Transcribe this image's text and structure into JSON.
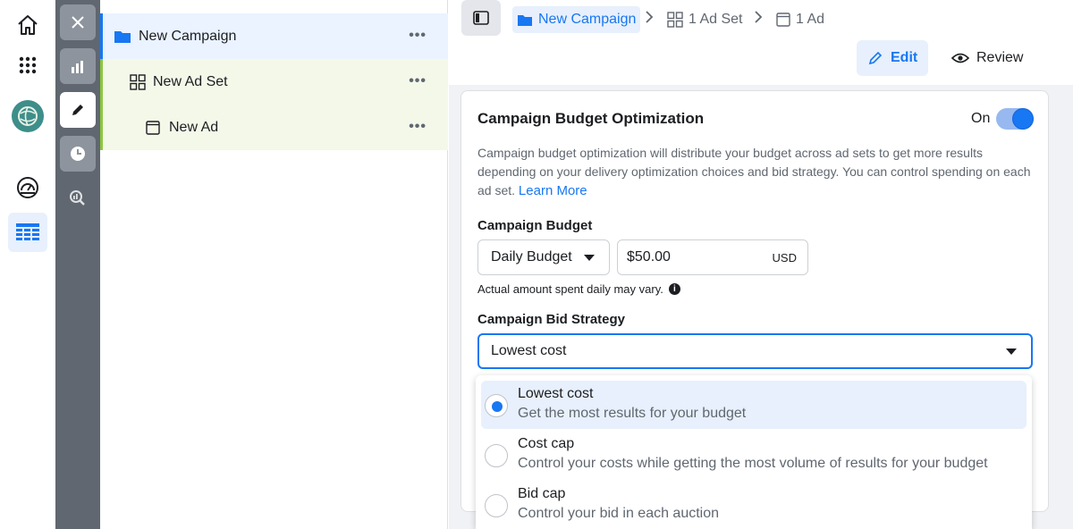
{
  "rail": {
    "items": [
      "home-icon",
      "apps-grid-icon",
      "account-avatar",
      "gauge-icon",
      "table-icon"
    ],
    "active_index": 4
  },
  "tools": {
    "items": [
      "close-icon",
      "chart-icon",
      "pencil-icon",
      "clock-icon",
      "search-chart-icon"
    ]
  },
  "tree": {
    "campaign_label": "New Campaign",
    "adset_label": "New Ad Set",
    "ad_label": "New Ad",
    "more_label": "•••"
  },
  "breadcrumb": {
    "campaign": "New Campaign",
    "adset": "1 Ad Set",
    "ad": "1 Ad"
  },
  "modes": {
    "edit_label": "Edit",
    "review_label": "Review"
  },
  "card": {
    "title": "Campaign Budget Optimization",
    "toggle_label": "On",
    "toggle_on": true,
    "description": "Campaign budget optimization will distribute your budget across ad sets to get more results depending on your delivery optimization choices and bid strategy. You can control spending on each ad set.",
    "learn_more": "Learn More",
    "budget_label": "Campaign Budget",
    "budget_type": "Daily Budget",
    "budget_amount": "$50.00",
    "currency": "USD",
    "budget_note": "Actual amount spent daily may vary.",
    "bid_label": "Campaign Bid Strategy",
    "bid_value": "Lowest cost"
  },
  "dropdown": {
    "options": [
      {
        "title": "Lowest cost",
        "subtitle": "Get the most results for your budget",
        "selected": true
      },
      {
        "title": "Cost cap",
        "subtitle": "Control your costs while getting the most volume of results for your budget",
        "selected": false
      },
      {
        "title": "Bid cap",
        "subtitle": "Control your bid in each auction",
        "selected": false
      }
    ]
  },
  "colors": {
    "accent": "#1877f2",
    "tool_rail": "#606770",
    "adset_highlight": "#8cc63f"
  }
}
